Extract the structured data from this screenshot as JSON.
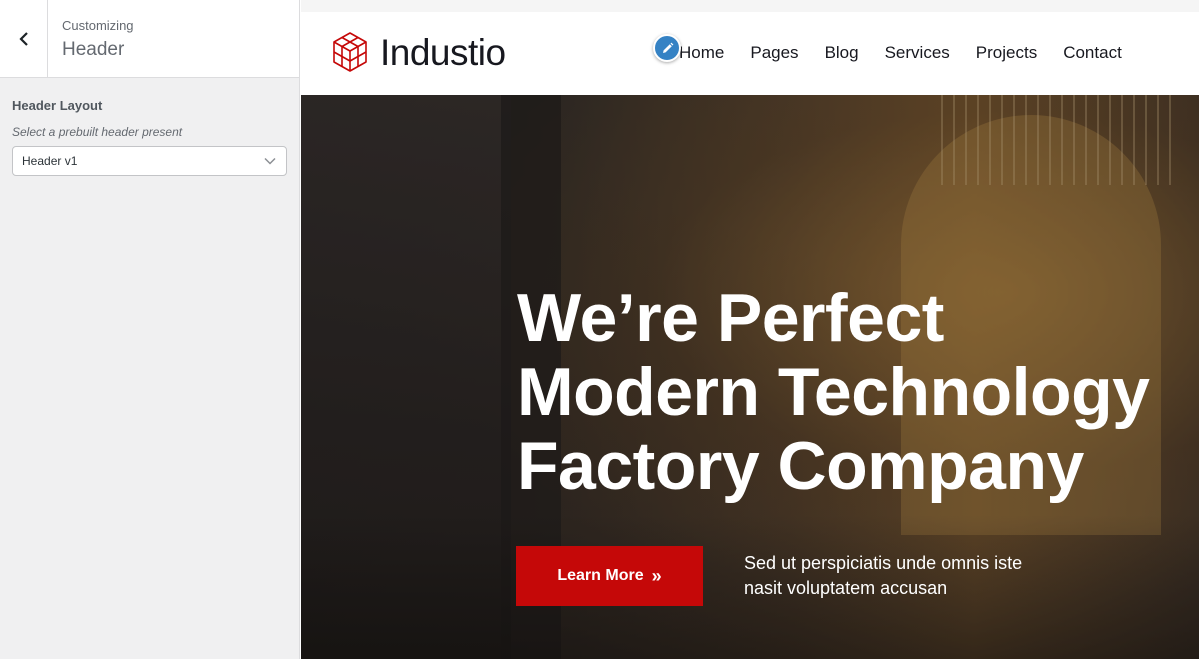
{
  "sidebar": {
    "breadcrumb": "Customizing",
    "title": "Header",
    "field_label": "Header Layout",
    "field_description": "Select a prebuilt header present",
    "select_value": "Header v1"
  },
  "site": {
    "logo_text": "Industio",
    "nav": [
      "Home",
      "Pages",
      "Blog",
      "Services",
      "Projects",
      "Contact"
    ],
    "brand_color": "#c50808"
  },
  "hero": {
    "title_lines": [
      "We’re Perfect",
      "Modern Technology",
      "Factory Company"
    ],
    "button_label": "Learn More",
    "button_icon": "double-chevron-right-icon",
    "description_lines": [
      "Sed ut perspiciatis unde omnis iste",
      "nasit voluptatem accusan"
    ]
  },
  "icons": {
    "back": "chevron-left-icon",
    "select_arrow": "chevron-down-icon",
    "edit": "pencil-icon",
    "logo": "cube-grid-logo-icon"
  }
}
